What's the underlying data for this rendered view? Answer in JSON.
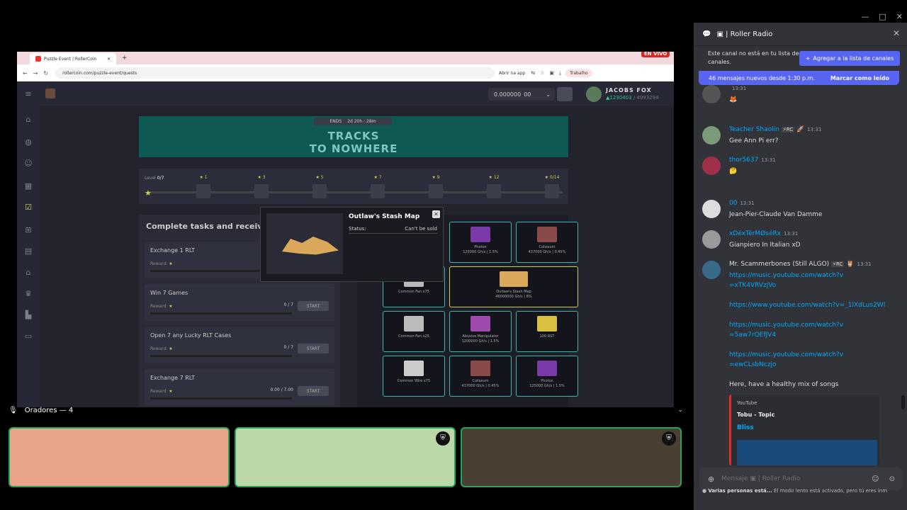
{
  "window": {
    "controls": [
      "—",
      "□",
      "✕"
    ]
  },
  "browser": {
    "tab_title": "Puzzle Event | RollerCoin",
    "live_badge": "EN VIVO",
    "url": "rollercoin.com/puzzle-event/quests",
    "open_in_app": "Abrir na app",
    "profile": "Trabalho"
  },
  "game": {
    "balance": "0.000000",
    "balance_unit": "00",
    "username": "JACOBS FOX",
    "power": "▲1230403",
    "power_suffix": " / 4993294",
    "ends_label": "ENDS",
    "ends_time": "2d 20h : 28m",
    "banner_title_1": "TRACKS",
    "banner_title_2": "TO NOWHERE",
    "level_label": "Level",
    "level_value": "0/7",
    "level_nodes": [
      "1",
      "3",
      "5",
      "7",
      "9",
      "12",
      "0/14"
    ],
    "tasks_title": "Complete tasks and receive a r",
    "tasks": [
      {
        "name": "Exchange 1 RLT",
        "reward": "Reward:",
        "progress": "",
        "button": ""
      },
      {
        "name": "Win 7 Games",
        "reward": "Reward:",
        "progress": "0 / 7",
        "button": "START"
      },
      {
        "name": "Open 7 any Lucky RLT Cases",
        "reward": "Reward:",
        "progress": "0 / 7",
        "button": "START"
      },
      {
        "name": "Exchange 7 RLT",
        "reward": "Reward:",
        "progress": "0.00 / 7.00",
        "button": "START"
      }
    ],
    "rewards": [
      {
        "name": "Photon",
        "stat": "125000 Gh/s | 1.5%",
        "color": "#7a3aa8"
      },
      {
        "name": "Coliseum",
        "stat": "437000 Gh/s | 0.45%",
        "color": "#8a4a4a"
      },
      {
        "name": "Common Fan x75",
        "stat": "",
        "color": "#bbbbbb"
      },
      {
        "name": "Outlaw's Stash Map",
        "stat": "46000000 Gh/s | 8%",
        "color": "#d9a85a"
      },
      {
        "name": "Common Fan x25",
        "stat": "",
        "color": "#bbbbbb"
      },
      {
        "name": "Abusive Manipulator",
        "stat": "1200000 Gh/s | 1.5%",
        "color": "#a04ab0"
      },
      {
        "name": "100 RST",
        "stat": "",
        "color": "#d8c040"
      },
      {
        "name": "Common Wire x75",
        "stat": "",
        "color": "#cccccc"
      },
      {
        "name": "Coliseum",
        "stat": "437000 Gh/s | 0.45%",
        "color": "#8a4a4a"
      },
      {
        "name": "Photon",
        "stat": "125000 Gh/s | 1.5%",
        "color": "#7a3aa8"
      }
    ],
    "popup": {
      "title": "Outlaw's Stash Map",
      "status_label": "Status:",
      "status_value": "Can't be sold"
    }
  },
  "speakers": {
    "title": "Oradores — 4",
    "tiles": [
      "#e8a58a",
      "#bcd8a8",
      "#4a3f33"
    ]
  },
  "discord": {
    "channel": "Roller Radio",
    "notice_text": "Este canal no está en tu lista de canales.",
    "notice_button": "Agregar a la lista de canales",
    "new_messages": "46 mensajes nuevos desde 1:30 p.m.",
    "mark_read": "Marcar como leído",
    "messages": [
      {
        "author": "",
        "time": "13:31",
        "text": "",
        "emoji": "🦊",
        "color": "#00a8fc"
      },
      {
        "author": "Teacher Shaolin",
        "time": "13:31",
        "text": "Gee Ann Pi err?",
        "emoji": "",
        "color": "#00a8fc"
      },
      {
        "author": "thor5637",
        "time": "13:31",
        "text": "",
        "emoji": "🤔",
        "color": "#00a8fc"
      },
      {
        "author": "00",
        "time": "13:31",
        "text": "Jean-Pier-Claude Van Damme",
        "emoji": "",
        "color": "#00a8fc"
      },
      {
        "author": "xDëxTërMØséRx",
        "time": "13:31",
        "text": "Gianpiero In Italian xD",
        "emoji": "",
        "color": "#00a8fc"
      },
      {
        "author": "Mr. Scammerbones (Still ALGO)",
        "time": "13:31",
        "text": "",
        "emoji": "",
        "color": "#dbdee1"
      }
    ],
    "links": [
      "https://music.youtube.com/watch?v=xTK4VRVzjVo",
      "https://www.youtube.com/watch?v=_1lXdLus2Wl",
      "https://music.youtube.com/watch?v=5aw7rQEfJV4",
      "https://music.youtube.com/watch?v=ewCLsbNczjo"
    ],
    "songs_text": "Here, have a healthy mix of songs",
    "embed": {
      "site": "YouTube",
      "channel": "Tobu - Topic",
      "title": "Bliss"
    },
    "composer_placeholder": "Mensaje",
    "composer_channel": "Roller Radio",
    "typing_names": "Varias personas está...",
    "typing_text": "El modo lento está activado, pero tú eres inm"
  }
}
